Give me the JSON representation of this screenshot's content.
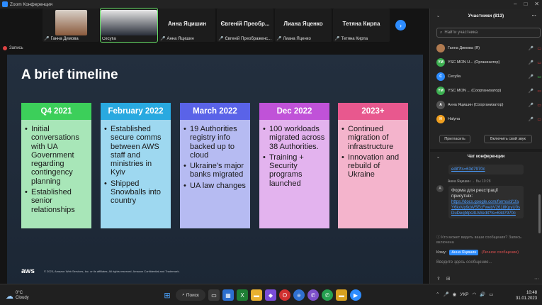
{
  "window": {
    "title": "Zoom Конференция",
    "close_label": "Закрыть"
  },
  "gallery": {
    "tiles": [
      {
        "name": "Ганна Димова",
        "big_name": ""
      },
      {
        "name": "Cecylia",
        "big_name": ""
      },
      {
        "name": "Анна Яцишин",
        "big_name": "Анна Яцишин"
      },
      {
        "name": "Євгеній Преображенс...",
        "big_name": "Євгеній Преобр..."
      },
      {
        "name": "Лиана Яценко",
        "big_name": "Лиана Яценко"
      },
      {
        "name": "Тетяна Кирпа",
        "big_name": "Тетяна Кирпа"
      }
    ],
    "next_icon": "chevron-right-icon"
  },
  "recording": {
    "label": "Запись"
  },
  "slide": {
    "title": "A brief timeline",
    "logo": "aws",
    "footer": "© 2023, Amazon Web Services, Inc. or its affiliates. All rights reserved. Amazon Confidential and Trademark.",
    "cards": [
      {
        "heading": "Q4 2021",
        "head_color": "#3ccf5a",
        "body_color": "#a8e6b8",
        "bullets": [
          "Initial conversations with UA Government regarding contingency planning",
          "Established senior relationships"
        ]
      },
      {
        "heading": "February 2022",
        "head_color": "#29a9e0",
        "body_color": "#9ed8f0",
        "bullets": [
          "Established secure comms between AWS staff and ministries in Kyiv",
          "Shipped Snowballs into country"
        ]
      },
      {
        "heading": "March 2022",
        "head_color": "#5a63e8",
        "body_color": "#b6bbf2",
        "bullets": [
          "19 Authorities registry info backed up to cloud",
          "Ukraine's major banks migrated",
          "UA law changes"
        ]
      },
      {
        "heading": "Dec 2022",
        "head_color": "#c052d8",
        "body_color": "#e3b3ee",
        "bullets": [
          "100 workloads migrated across 38 Authorities.",
          "Training + Security programs launched"
        ]
      },
      {
        "heading": "2023+",
        "head_color": "#e8588e",
        "body_color": "#f4b4cc",
        "bullets": [
          "Continued migration of infrastructure",
          "Innovation and rebuild of Ukraine"
        ]
      }
    ]
  },
  "participants": {
    "header": "Участники (813)",
    "search_placeholder": "Найти участника",
    "list": [
      {
        "initials": "",
        "name": "Ганна Димова (Я)",
        "color": "#b07a50",
        "video": "off"
      },
      {
        "initials": "YM",
        "name": "YSC MON U... (Организатор)",
        "color": "#3caf50",
        "video": "off"
      },
      {
        "initials": "C",
        "name": "Cecylia",
        "color": "#2d8cff",
        "video": "on"
      },
      {
        "initials": "YM",
        "name": "YSC MON ... (Соорганизатор)",
        "color": "#3caf50",
        "video": "off"
      },
      {
        "initials": "A",
        "name": "Анна Яцишин (Соорганизатор)",
        "color": "#555555",
        "video": "off"
      },
      {
        "initials": "H",
        "name": "Halyna",
        "color": "#f0a020",
        "video": "off"
      }
    ],
    "invite_label": "Пригласить",
    "unmute_label": "Включить свой звук"
  },
  "chat": {
    "header": "Чат конференции",
    "prev_link_tail": "edit?ts=63d7970c",
    "sender": "Анна Яцишин",
    "sender_suffix": "Вы",
    "time": "10:28",
    "avatar": "A",
    "message_text": "Форма для реєстрації присутніх:",
    "message_link": "https://docs.google.com/forms/d/1faY6kxVp9qWSEcFwebV2618KpyU0sDuDeqbtps3LM/edit?ts=63d7970c",
    "who_can_see": "Кто может видеть ваши сообщения? Запись включена",
    "to_label": "Кому:",
    "to_value": "Анна Яцишин",
    "to_private": "(Личное сообщение)",
    "input_placeholder": "Введите здесь сообщение..."
  },
  "taskbar": {
    "temperature": "0°C",
    "weather": "Cloudy",
    "search_label": "Поиск",
    "language": "УКР",
    "time": "10:48",
    "date": "31.01.2023"
  }
}
